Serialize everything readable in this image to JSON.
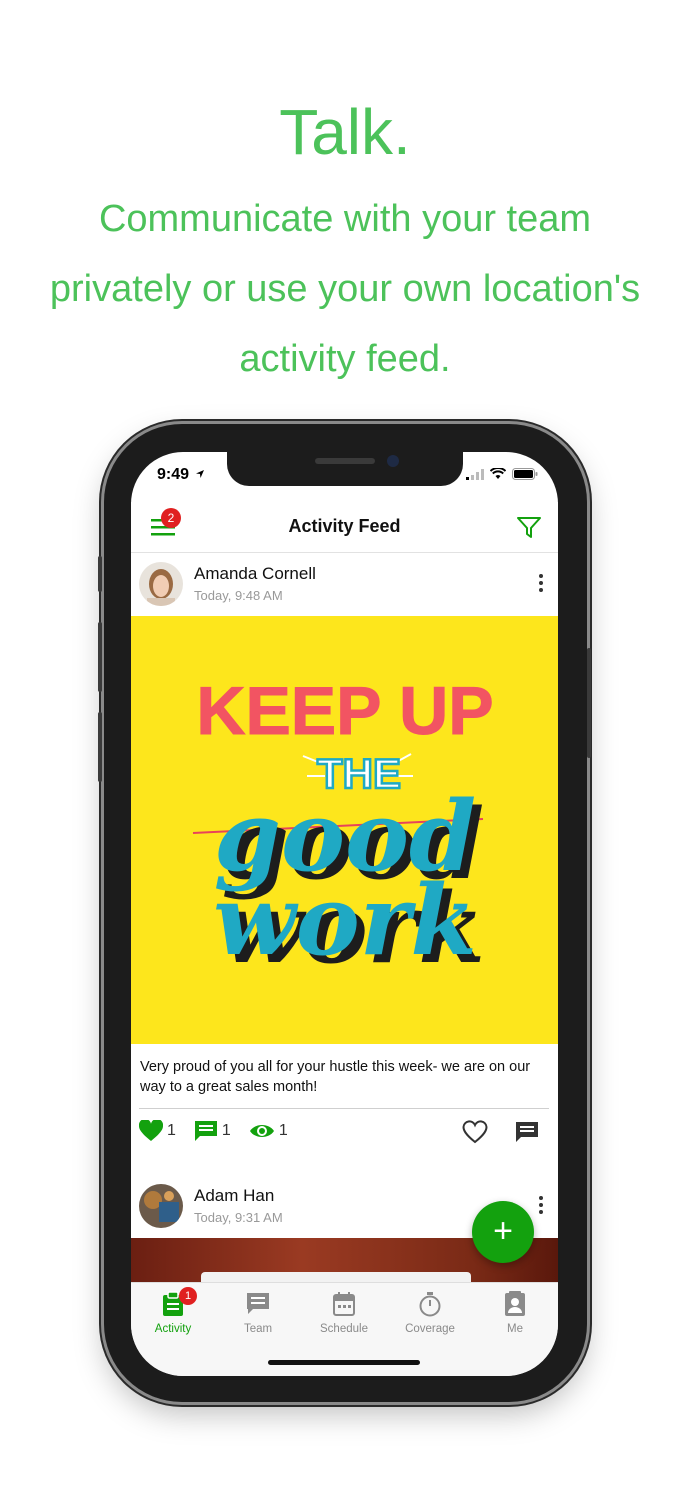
{
  "headline": {
    "title": "Talk.",
    "subtitle_line1": "Communicate with your team",
    "subtitle_line2": "privately or use your own location's",
    "subtitle_line3": "activity feed."
  },
  "status_bar": {
    "time": "9:49",
    "icons": [
      "location-arrow-icon",
      "signal-icon",
      "wifi-icon",
      "battery-icon"
    ]
  },
  "header": {
    "title": "Activity Feed",
    "menu_badge": "2",
    "menu_icon": "hamburger-menu-icon",
    "filter_icon": "filter-icon"
  },
  "posts": [
    {
      "author": "Amanda Cornell",
      "timestamp": "Today, 9:48 AM",
      "image_text": {
        "line1": "KEEP UP",
        "line2": "THE",
        "line3": "good",
        "line4": "work"
      },
      "text": "Very proud of you all for your hustle this week- we are on our way to a great sales month!",
      "likes": "1",
      "comments": "1",
      "views": "1"
    },
    {
      "author": "Adam Han",
      "timestamp": "Today, 9:31 AM"
    }
  ],
  "fab": {
    "label": "+"
  },
  "tabs": [
    {
      "label": "Activity",
      "icon": "clipboard-icon",
      "badge": "1",
      "active": true
    },
    {
      "label": "Team",
      "icon": "chat-bubble-icon"
    },
    {
      "label": "Schedule",
      "icon": "calendar-icon"
    },
    {
      "label": "Coverage",
      "icon": "stopwatch-icon"
    },
    {
      "label": "Me",
      "icon": "contact-card-icon"
    }
  ],
  "colors": {
    "accent": "#13a10e",
    "headline": "#4cc25a",
    "badge": "#e02020",
    "image_bg": "#fde61c"
  }
}
